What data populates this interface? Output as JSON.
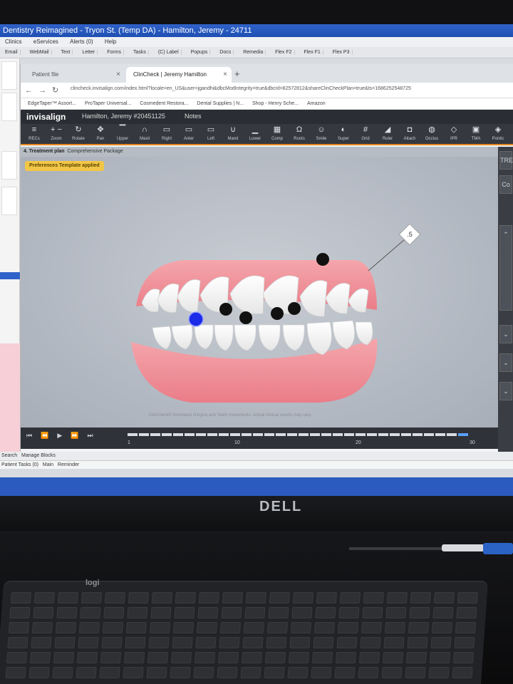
{
  "ehr": {
    "title": "Dentistry Reimagined - Tryon St. (Temp DA) - Hamilton, Jeremy - 24711",
    "menu": [
      "Clinics",
      "eServices",
      "Alerts (0)",
      "Help"
    ],
    "toolbar": [
      "Email",
      "WebMail",
      "Text",
      "Letter",
      "Forms",
      "Tasks",
      "(C) Label",
      "Popups",
      "Docs",
      "Remedia",
      "Flex F2",
      "Flex F1",
      "Flex P3"
    ],
    "bottom1": [
      "Search",
      "Manage Blocks"
    ],
    "bottom2": [
      "Patient Tasks (0)",
      "Main",
      "Reminder"
    ]
  },
  "browser": {
    "tabs": [
      {
        "label": "Patient file",
        "active": false
      },
      {
        "label": "ClinCheck | Jeremy Hamilton",
        "active": true
      }
    ],
    "url": "clincheck.invisalign.com/index.html?locale=en_US&user=jgandhi&dbcModIntegrity=true&dbcId=82572812&shareClinCheckPlan=true&ts=1686252548725",
    "bookmarks": [
      "EdgeTaper™ Assort...",
      "ProTaper Universal...",
      "Cosmedent Restora...",
      "Dental Supplies | N...",
      "Shop - Henry Sche...",
      "Amazon"
    ]
  },
  "invisalign": {
    "logo": "invisalign",
    "patient": "Hamilton, Jeremy #20451125",
    "notes": "Notes",
    "tools": [
      {
        "icon": "recs-icon",
        "glyph": "≡",
        "label": "RECs"
      },
      {
        "icon": "zoom-icon",
        "glyph": "+ −",
        "label": "Zoom"
      },
      {
        "icon": "rotate-icon",
        "glyph": "↻",
        "label": "Rotate"
      },
      {
        "icon": "pan-icon",
        "glyph": "✥",
        "label": "Pan"
      },
      {
        "icon": "upper-icon",
        "glyph": "▔",
        "label": "Upper"
      },
      {
        "icon": "maxil-icon",
        "glyph": "∩",
        "label": "Maxil"
      },
      {
        "icon": "right-icon",
        "glyph": "▭",
        "label": "Right"
      },
      {
        "icon": "anter-icon",
        "glyph": "▭",
        "label": "Anter"
      },
      {
        "icon": "left-icon",
        "glyph": "▭",
        "label": "Left"
      },
      {
        "icon": "mand-icon",
        "glyph": "∪",
        "label": "Mand"
      },
      {
        "icon": "lower-icon",
        "glyph": "▁",
        "label": "Lower"
      },
      {
        "icon": "comp-icon",
        "glyph": "▦",
        "label": "Comp"
      },
      {
        "icon": "roots-icon",
        "glyph": "Ω",
        "label": "Roots"
      },
      {
        "icon": "smile-icon",
        "glyph": "☺",
        "label": "Smile"
      },
      {
        "icon": "super-icon",
        "glyph": "◐",
        "label": "Super"
      },
      {
        "icon": "grid-icon",
        "glyph": "#",
        "label": "Grid"
      },
      {
        "icon": "ruler-icon",
        "glyph": "◢",
        "label": "Ruler"
      },
      {
        "icon": "attach-icon",
        "glyph": "◘",
        "label": "Attach"
      },
      {
        "icon": "occlus-icon",
        "glyph": "◍",
        "label": "Occlus"
      },
      {
        "icon": "ipr-icon",
        "glyph": "◇",
        "label": "IPR"
      },
      {
        "icon": "tma-icon",
        "glyph": "▣",
        "label": "TMA"
      },
      {
        "icon": "pontic-icon",
        "glyph": "◈",
        "label": "Pontic"
      }
    ],
    "treatment_label": "4. Treatment plan",
    "package": "Comprehensive Package",
    "pref_badge": "Preferences Template applied",
    "ipr_value": ".5",
    "disclaimer": "ClinCheck® Simulated Gingiva and Teeth movements. Actual clinical results may vary.",
    "right_panel": [
      "TRE",
      "Co"
    ],
    "timeline_labels": [
      "1",
      "10",
      "20",
      "30"
    ],
    "timeline": {
      "stages": 30,
      "current": 30
    }
  },
  "monitor": {
    "brand": "DELL"
  },
  "keyboard": {
    "brand": "logi"
  },
  "colors": {
    "invisalign_accent": "#e8851d",
    "ehr_blue": "#2b5bbf",
    "badge": "#f2c646",
    "selected_dot": "#1b2be8"
  }
}
